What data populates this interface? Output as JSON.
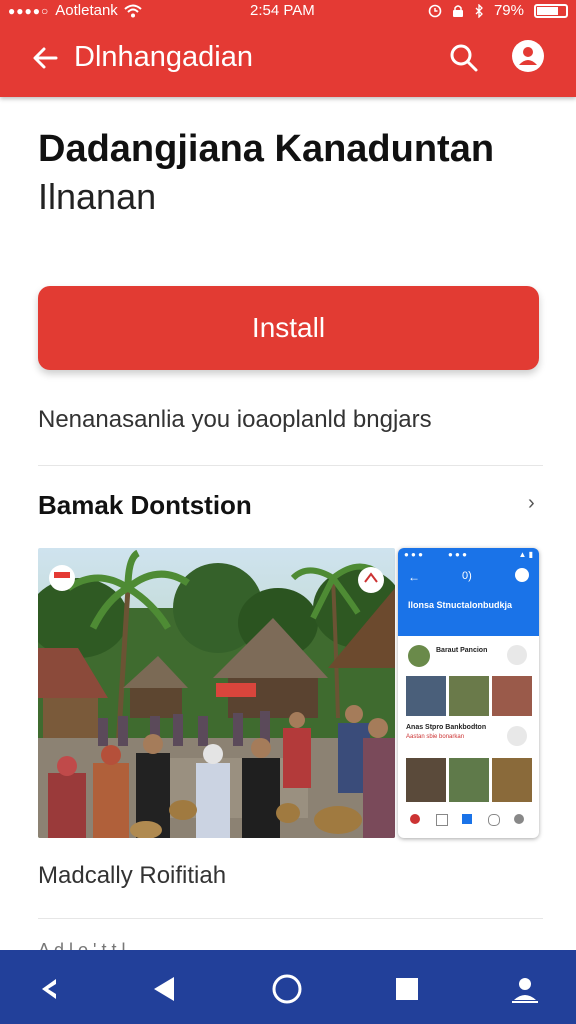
{
  "status_bar": {
    "carrier": "Aotletank",
    "time": "2:54 PAM",
    "battery": "79%",
    "battery_level": 0.79
  },
  "app_bar": {
    "title": "Dlnhangadian",
    "back_icon": "arrow-left-icon",
    "search_icon": "search-icon",
    "account_icon": "account-icon"
  },
  "app": {
    "name_line1": "Dadangjiana Kanaduntan",
    "name_line2": "Ilnanan",
    "install_label": "Install",
    "tagline": "Nenanasanlia you ioaoplanld bngjars"
  },
  "section": {
    "title": "Bamak Dontstion",
    "arrow": "›"
  },
  "screenshot_phone": {
    "header_left": "←",
    "header_center": "0)",
    "header_title": "Ilonsa Stnuctalonbudkja",
    "row1_label": "Baraut Pancion",
    "row2_label": "Anas Stpro Bankbodton",
    "row2_sub": "Aastan sbie bonarkan"
  },
  "caption": "Madcally Roifitiah",
  "partial_text": "A d l o ' t t l"
}
